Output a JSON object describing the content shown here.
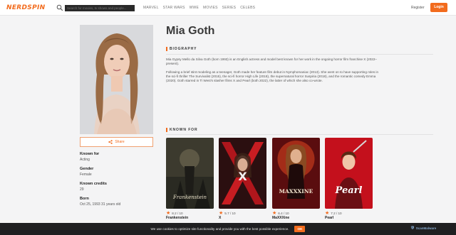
{
  "header": {
    "logo": "NERDSPIN",
    "search_placeholder": "Search for movies, tv shows and people...",
    "nav": [
      "MARVEL",
      "STAR WARS",
      "WWE",
      "MOVIES",
      "SERIES",
      "CELEBS"
    ],
    "register": "Register",
    "login": "Login",
    "accent": "#f26b1d"
  },
  "profile": {
    "name": "Mia Goth",
    "share": "Share",
    "facts": [
      {
        "label": "Known for",
        "value": "Acting"
      },
      {
        "label": "Gender",
        "value": "Female"
      },
      {
        "label": "Known credits",
        "value": "29"
      },
      {
        "label": "Born",
        "value": "Oct 25, 1993 31 years old"
      }
    ]
  },
  "biography": {
    "heading": "BIOGRAPHY",
    "paragraphs": [
      "Mia Gypsy Mello da Silva Goth (born 1993) is an English actress and model best known for her work in the ongoing horror film franchise X (2022–present).",
      "Following a brief stint modeling as a teenager, Goth made her feature film debut in Nymphomaniac (2013). She went on to have supporting roles in the sci-fi thriller The Survivalist (2015), the sci-fi horror High Life (2018), the supernatural horror Suspiria (2018), and the romantic comedy Emma (2020). Goth starred in Ti West's slasher films X and Pearl (both 2022), the latter of which she also co-wrote."
    ]
  },
  "known_for": {
    "heading": "KNOWN FOR",
    "movies": [
      {
        "title": "Frankenstein",
        "rating": "8.2 / 10",
        "poster_text": "Frankenstein"
      },
      {
        "title": "X",
        "rating": "5.7 / 10",
        "poster_text": "X"
      },
      {
        "title": "MaXXXine",
        "rating": "6.4 / 10",
        "poster_text": "MAXXXINE"
      },
      {
        "title": "Pearl",
        "rating": "7.2 / 10",
        "poster_text": "Pearl"
      }
    ]
  },
  "cookie": {
    "text": "We use cookies to optimize site functionality and provide you with the best possible experience.",
    "ok": "OK"
  },
  "watermark": "ScanMalware"
}
